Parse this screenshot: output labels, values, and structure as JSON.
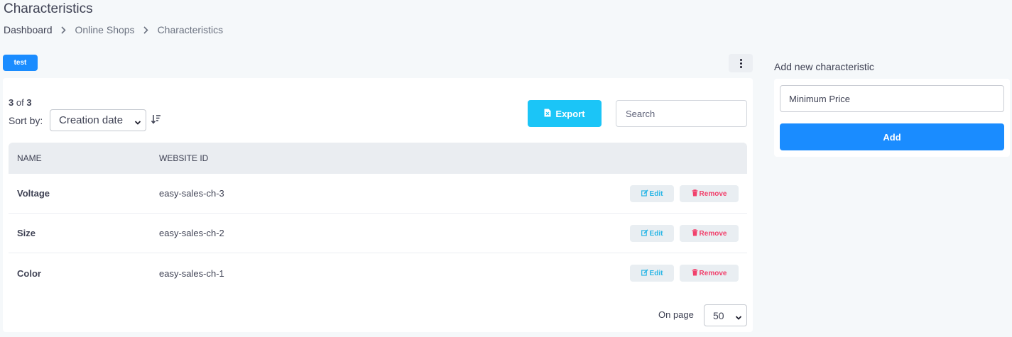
{
  "page": {
    "title": "Characteristics"
  },
  "breadcrumb": {
    "items": [
      "Dashboard",
      "Online Shops",
      "Characteristics"
    ]
  },
  "toolbar": {
    "tag_label": "test"
  },
  "list": {
    "count_shown": "3",
    "count_of": "of",
    "count_total": "3",
    "sort_label": "Sort by:",
    "sort_value": "Creation date",
    "export_label": "Export",
    "search_placeholder": "Search",
    "columns": [
      "NAME",
      "WEBSITE ID"
    ],
    "rows": [
      {
        "name": "Voltage",
        "website_id": "easy-sales-ch-3"
      },
      {
        "name": "Size",
        "website_id": "easy-sales-ch-2"
      },
      {
        "name": "Color",
        "website_id": "easy-sales-ch-1"
      }
    ],
    "edit_label": "Edit",
    "remove_label": "Remove",
    "on_page_label": "On page",
    "on_page_value": "50"
  },
  "side": {
    "title": "Add new characteristic",
    "input_value": "Minimum Price",
    "add_label": "Add"
  },
  "colors": {
    "primary": "#1a8cff",
    "info": "#1bc5f7",
    "danger": "#f1416c",
    "background": "#f5f8fa"
  },
  "icons": [
    "chevron-right-icon",
    "more-vertical-icon",
    "sort-desc-icon",
    "file-excel-icon",
    "edit-icon",
    "trash-icon",
    "chevron-down-icon"
  ]
}
